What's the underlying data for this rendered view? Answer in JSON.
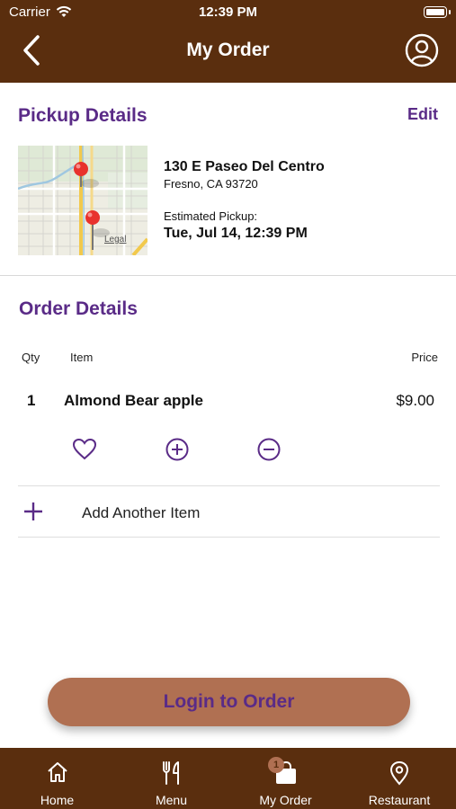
{
  "status_bar": {
    "carrier": "Carrier",
    "time": "12:39 PM"
  },
  "header": {
    "title": "My Order",
    "back_icon": "chevron-left-icon",
    "profile_icon": "user-circle-icon"
  },
  "pickup": {
    "title": "Pickup Details",
    "edit_label": "Edit",
    "address_line1": "130 E Paseo Del Centro",
    "address_line2": "Fresno, CA 93720",
    "estimated_label": "Estimated Pickup:",
    "estimated_time": "Tue, Jul 14, 12:39 PM",
    "map_legal": "Legal"
  },
  "order": {
    "title": "Order Details",
    "columns": {
      "qty": "Qty",
      "item": "Item",
      "price": "Price"
    },
    "items": [
      {
        "qty": "1",
        "name": "Almond Bear apple",
        "price": "$9.00"
      }
    ],
    "add_another_label": "Add Another Item"
  },
  "login_button": "Login to Order",
  "tabs": [
    {
      "label": "Home",
      "icon": "home-icon"
    },
    {
      "label": "Menu",
      "icon": "utensils-icon"
    },
    {
      "label": "My Order",
      "icon": "shopping-bag-icon",
      "badge": "1"
    },
    {
      "label": "Restaurant",
      "icon": "map-pin-icon"
    }
  ],
  "colors": {
    "brand_brown": "#5a2e0e",
    "accent_purple": "#5a2b87",
    "button_copper": "#b07052"
  }
}
